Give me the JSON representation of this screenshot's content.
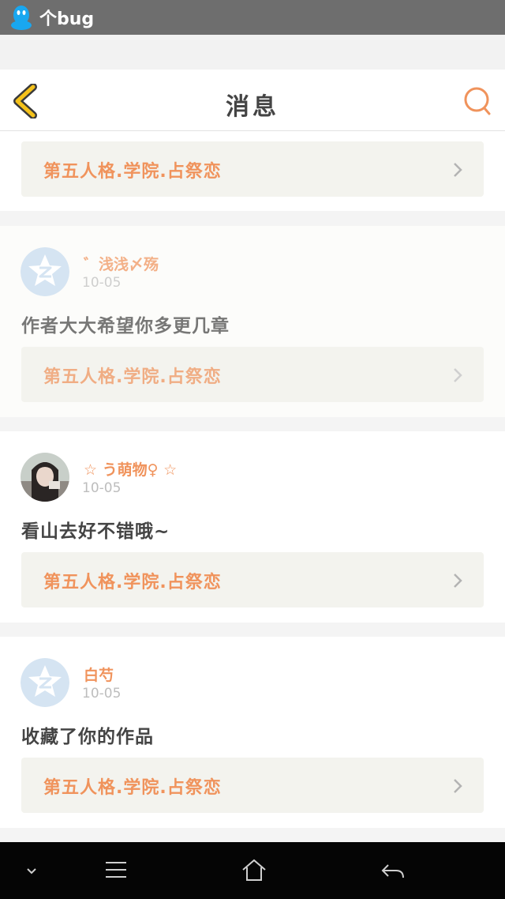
{
  "status_bar": {
    "text": "个bug"
  },
  "header": {
    "title": "消息"
  },
  "feed": {
    "partial_card": {
      "work_title": "第五人格.学院.占祭恋"
    },
    "messages": [
      {
        "name": "゛浅浅〆殇",
        "date": "10-05",
        "comment": "作者大大希望你多更几章",
        "work_title": "第五人格.学院.占祭恋",
        "avatar": "default-avatar-icon"
      },
      {
        "name": "☆ う萌物♀ ☆",
        "date": "10-05",
        "comment": "看山去好不错哦~",
        "work_title": "第五人格.学院.占祭恋",
        "avatar": "user-photo"
      },
      {
        "name": "白芍",
        "date": "10-05",
        "comment": "收藏了你的作品",
        "work_title": "第五人格.学院.占祭恋",
        "avatar": "default-avatar-icon"
      }
    ]
  },
  "colors": {
    "accent": "#f0935c",
    "text": "#444444",
    "muted": "#bdbdbd",
    "status_bar": "#6e6e6e",
    "back_icon": "#f5c21b"
  },
  "icons": {
    "status_bar": "qq-penguin-icon",
    "header_left": "back-chevron-icon",
    "header_right": "search-icon",
    "nav": [
      "dropdown-arrow-icon",
      "menu-icon",
      "home-icon",
      "back-arrow-icon"
    ]
  }
}
